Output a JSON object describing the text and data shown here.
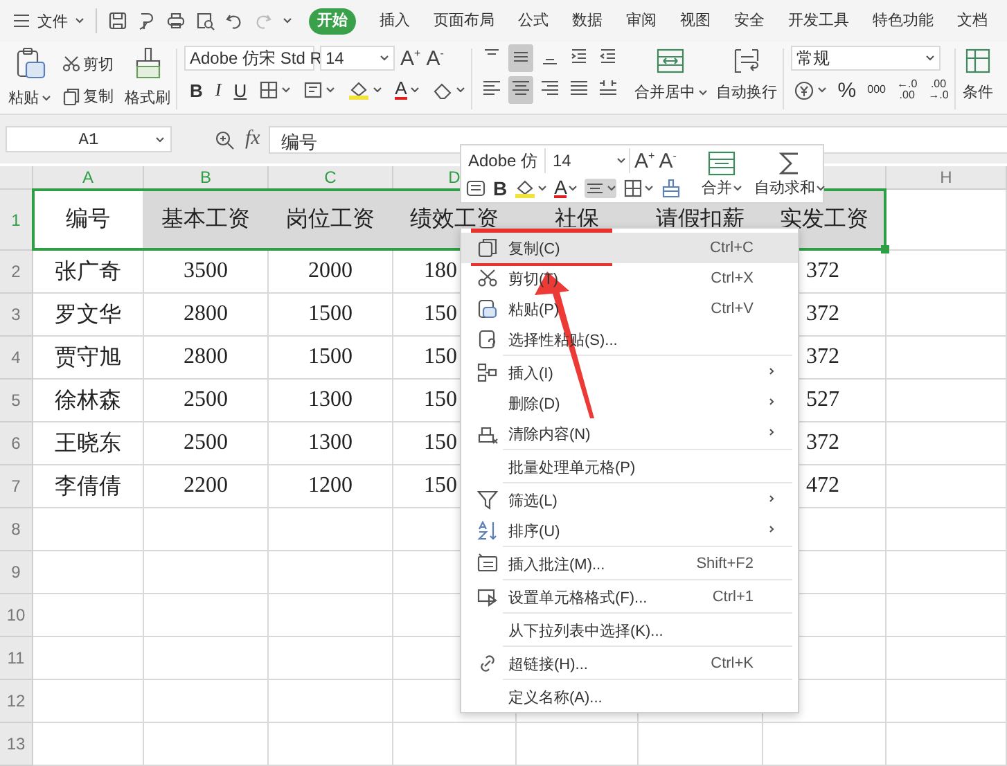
{
  "menubar": {
    "file": "文件",
    "tabs": [
      {
        "label": "开始",
        "selected": true
      },
      {
        "label": "插入",
        "selected": false
      },
      {
        "label": "页面布局",
        "selected": false
      },
      {
        "label": "公式",
        "selected": false
      },
      {
        "label": "数据",
        "selected": false
      },
      {
        "label": "审阅",
        "selected": false
      },
      {
        "label": "视图",
        "selected": false
      },
      {
        "label": "安全",
        "selected": false
      },
      {
        "label": "开发工具",
        "selected": false
      },
      {
        "label": "特色功能",
        "selected": false
      },
      {
        "label": "文档",
        "selected": false
      }
    ]
  },
  "ribbon": {
    "clipboard": {
      "paste": "粘贴",
      "cut": "剪切",
      "copy": "复制",
      "format_painter": "格式刷"
    },
    "font": {
      "name": "Adobe 仿宋 Std R",
      "size": "14",
      "grow": "A$^{+}$",
      "shrink": "A$^{-}$",
      "styles": [
        "B",
        "I",
        "U"
      ],
      "font_color": "A"
    },
    "alignment": {
      "top_row": [
        {
          "pressed": false
        },
        {
          "pressed": true
        },
        {
          "pressed": false
        },
        {
          "pressed": false
        },
        {
          "pressed": false
        }
      ],
      "bottom_row": [
        {
          "pressed": false
        },
        {
          "pressed": true
        },
        {
          "pressed": false
        },
        {
          "pressed": false
        },
        {
          "pressed": false
        }
      ],
      "merge": "合并居中",
      "wrap": "自动换行"
    },
    "number": {
      "format": "常规",
      "percent": "%",
      "thousands": "000",
      "decimal_buttons": [
        {
          "top": "←.0",
          "bottom": ".00"
        },
        {
          "top": ".00",
          "bottom": "→.0"
        }
      ]
    },
    "conditional": "条件"
  },
  "formula_bar": {
    "name_box": "A1",
    "fx": "fx",
    "content": "编号"
  },
  "sheet": {
    "columns": [
      {
        "label": "A",
        "selected": true
      },
      {
        "label": "B",
        "selected": true
      },
      {
        "label": "C",
        "selected": true
      },
      {
        "label": "D",
        "selected": true
      }
    ],
    "column_h": {
      "label": "H",
      "selected": false
    },
    "rows": [
      {
        "number": "1",
        "selected": true,
        "cells": [
          "编号",
          "基本工资",
          "岗位工资",
          "绩效工资",
          "社保",
          "请假扣薪",
          "实发工资"
        ]
      },
      {
        "number": "2",
        "selected": false,
        "cells": [
          "张广奇",
          "3500",
          "2000",
          "180"
        ],
        "column_g": "372"
      },
      {
        "number": "3",
        "selected": false,
        "cells": [
          "罗文华",
          "2800",
          "1500",
          "150"
        ],
        "column_g": "372"
      },
      {
        "number": "4",
        "selected": false,
        "cells": [
          "贾守旭",
          "2800",
          "1500",
          "150"
        ],
        "column_g": "372"
      },
      {
        "number": "5",
        "selected": false,
        "cells": [
          "徐林森",
          "2500",
          "1300",
          "150"
        ],
        "column_g": "527"
      },
      {
        "number": "6",
        "selected": false,
        "cells": [
          "王晓东",
          "2500",
          "1300",
          "150"
        ],
        "column_g": "372"
      },
      {
        "number": "7",
        "selected": false,
        "cells": [
          "李倩倩",
          "2200",
          "1200",
          "150"
        ],
        "column_g": "472"
      },
      {
        "number": "8",
        "selected": false
      },
      {
        "number": "9",
        "selected": false
      },
      {
        "number": "10",
        "selected": false
      },
      {
        "number": "11",
        "selected": false
      },
      {
        "number": "12",
        "selected": false
      },
      {
        "number": "13",
        "selected": false
      }
    ]
  },
  "mini_toolbar": {
    "font": "Adobe 仿",
    "size": "14",
    "grow": "A$^{+}$",
    "shrink": "A$^{-}$",
    "bold": "B",
    "font_color": "A",
    "align_pressed": true,
    "merge": "合并",
    "autosum": "自动求和"
  },
  "context_menu": {
    "groups": [
      [
        {
          "label": "复制(C)",
          "shortcut": "Ctrl+C",
          "submenu": false,
          "selected": true
        },
        {
          "label": "剪切(T)",
          "shortcut": "Ctrl+X",
          "submenu": false,
          "selected": false
        },
        {
          "label": "粘贴(P)",
          "shortcut": "Ctrl+V",
          "submenu": false,
          "selected": false
        },
        {
          "label": "选择性粘贴(S)...",
          "submenu": false,
          "selected": false
        }
      ],
      [
        {
          "label": "插入(I)",
          "submenu": true,
          "selected": false
        },
        {
          "label": "删除(D)",
          "submenu": true,
          "selected": false
        },
        {
          "label": "清除内容(N)",
          "submenu": true,
          "selected": false
        }
      ],
      [
        {
          "label": "批量处理单元格(P)",
          "submenu": false,
          "selected": false
        }
      ],
      [
        {
          "label": "筛选(L)",
          "submenu": true,
          "selected": false
        },
        {
          "label": "排序(U)",
          "submenu": true,
          "selected": false
        }
      ],
      [
        {
          "label": "插入批注(M)...",
          "shortcut": "Shift+F2",
          "submenu": false,
          "selected": false
        }
      ],
      [
        {
          "label": "设置单元格格式(F)...",
          "shortcut": "Ctrl+1",
          "submenu": false,
          "selected": false
        }
      ],
      [
        {
          "label": "从下拉列表中选择(K)...",
          "submenu": false,
          "selected": false
        }
      ],
      [
        {
          "label": "超链接(H)...",
          "shortcut": "Ctrl+K",
          "submenu": false,
          "selected": false
        }
      ],
      [
        {
          "label": "定义名称(A)...",
          "submenu": false,
          "selected": false
        }
      ]
    ]
  }
}
